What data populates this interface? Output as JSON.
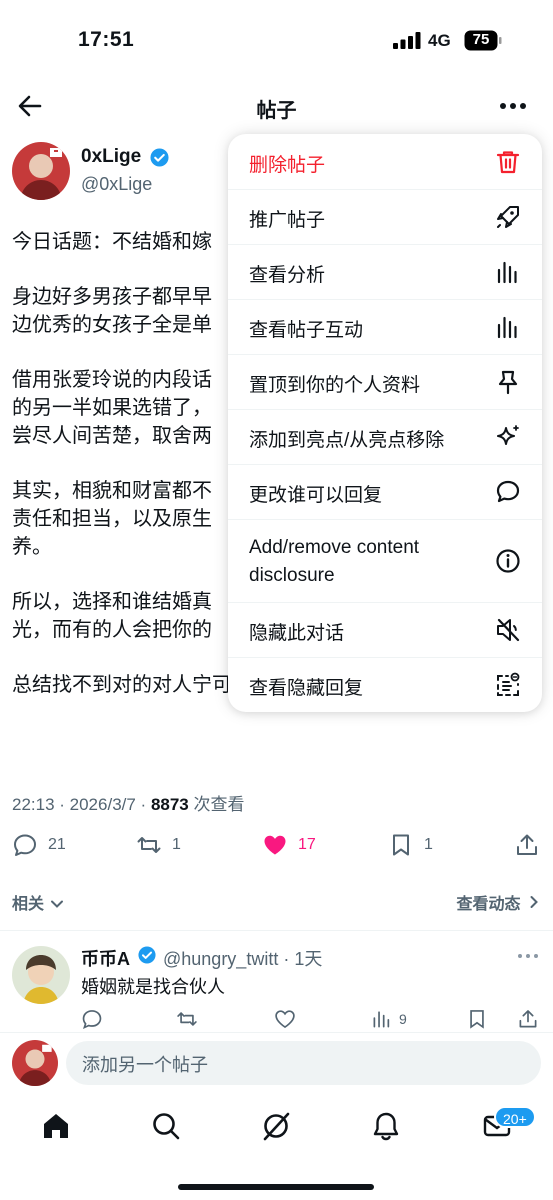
{
  "status_bar": {
    "time": "17:51",
    "network": "4G",
    "battery": "75"
  },
  "header": {
    "title": "帖子"
  },
  "author": {
    "name": "0xLige",
    "handle": "@0xLige"
  },
  "post": {
    "paragraphs": [
      "今日话题：不结婚和嫁",
      "身边好多男孩子都早早\n边优秀的女孩子全是单",
      "借用张爱玲说的内段话\n的另一半如果选错了，\n尝尽人间苦楚，取舍两",
      "其实，相貌和财富都不\n责任和担当，以及原生\n养。",
      "所以，选择和谁结婚真\n光，而有的人会把你的",
      "总结找不到对的对人宁可不嫁 @她"
    ],
    "time": "22:13 · 2026/3/7 · ",
    "views": "8873",
    "views_label": " 次查看"
  },
  "actions": {
    "replies": "21",
    "reposts": "1",
    "likes": "17",
    "bookmarks": "1"
  },
  "related_label": "相关",
  "activity_label": "查看动态",
  "reply": {
    "name": "币币A",
    "handle": "@hungry_twitt · 1天",
    "text": "婚姻就是找合伙人",
    "views": "9"
  },
  "compose": {
    "placeholder": "添加另一个帖子"
  },
  "tabbar": {
    "badge": "20+"
  },
  "menu": {
    "items": [
      {
        "label": "删除帖子",
        "icon": "trash-icon"
      },
      {
        "label": "推广帖子",
        "icon": "rocket-icon"
      },
      {
        "label": "查看分析",
        "icon": "analytics-icon"
      },
      {
        "label": "查看帖子互动",
        "icon": "analytics-icon"
      },
      {
        "label": "置顶到你的个人资料",
        "icon": "pin-icon"
      },
      {
        "label": "添加到亮点/从亮点移除",
        "icon": "sparkle-icon"
      },
      {
        "label": "更改谁可以回复",
        "icon": "speech-bubble-icon"
      },
      {
        "label": "Add/remove content disclosure",
        "icon": "info-icon"
      },
      {
        "label": "隐藏此对话",
        "icon": "mute-icon"
      },
      {
        "label": "查看隐藏回复",
        "icon": "hidden-replies-icon"
      }
    ]
  },
  "colors": {
    "accent": "#1d9bf0",
    "danger": "#f4212e",
    "like": "#f91880",
    "secondary": "#536471"
  }
}
